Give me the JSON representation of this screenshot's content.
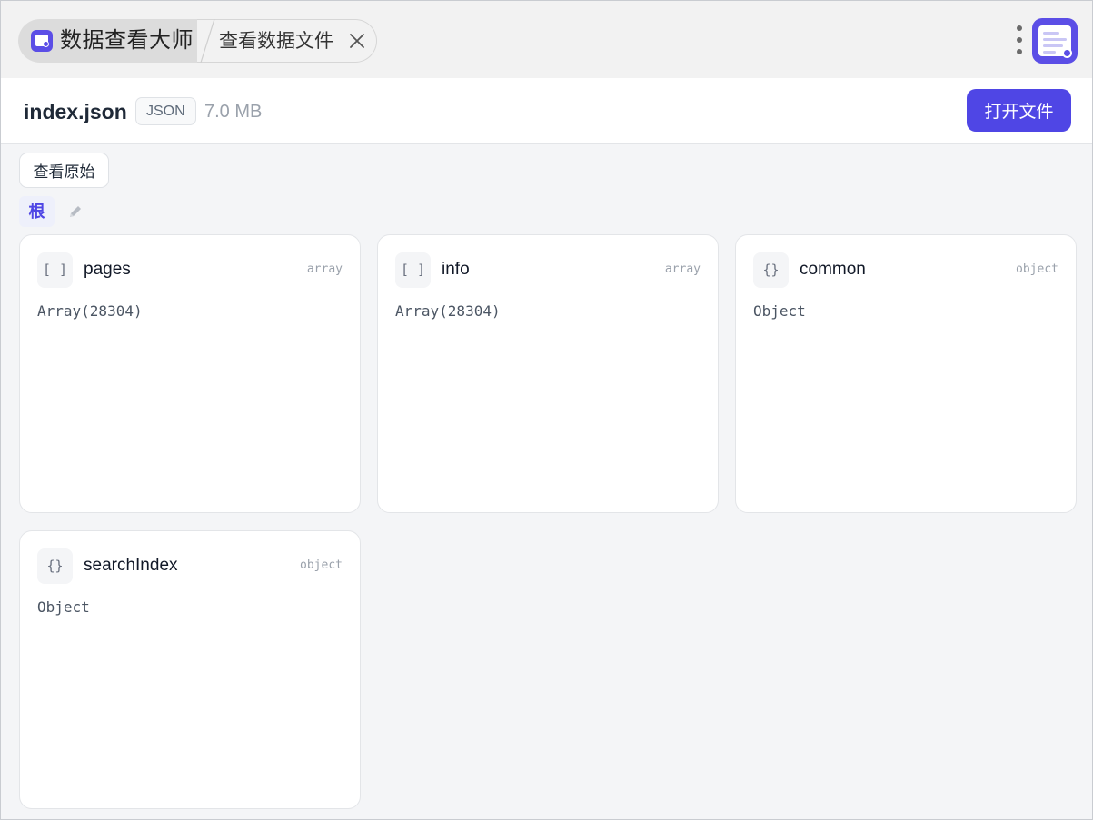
{
  "titlebar": {
    "app_name": "数据查看大师",
    "doc_tab_title": "查看数据文件",
    "icons": [
      "app-logo-icon",
      "close-icon",
      "more-vertical-icon",
      "document-search-icon"
    ]
  },
  "file": {
    "name": "index.json",
    "type_badge": "JSON",
    "size": "7.0 MB",
    "open_button_label": "打开文件"
  },
  "toolbar": {
    "view_raw_label": "查看原始",
    "breadcrumb_root": "根"
  },
  "cards": [
    {
      "icon": "[ ]",
      "key": "pages",
      "type": "array",
      "preview": "Array(28304)"
    },
    {
      "icon": "[ ]",
      "key": "info",
      "type": "array",
      "preview": "Array(28304)"
    },
    {
      "icon": "{}",
      "key": "common",
      "type": "object",
      "preview": "Object"
    },
    {
      "icon": "{}",
      "key": "searchIndex",
      "type": "object",
      "preview": "Object"
    }
  ],
  "colors": {
    "accent": "#4f46e5",
    "background": "#f4f5f7",
    "card": "#ffffff"
  }
}
